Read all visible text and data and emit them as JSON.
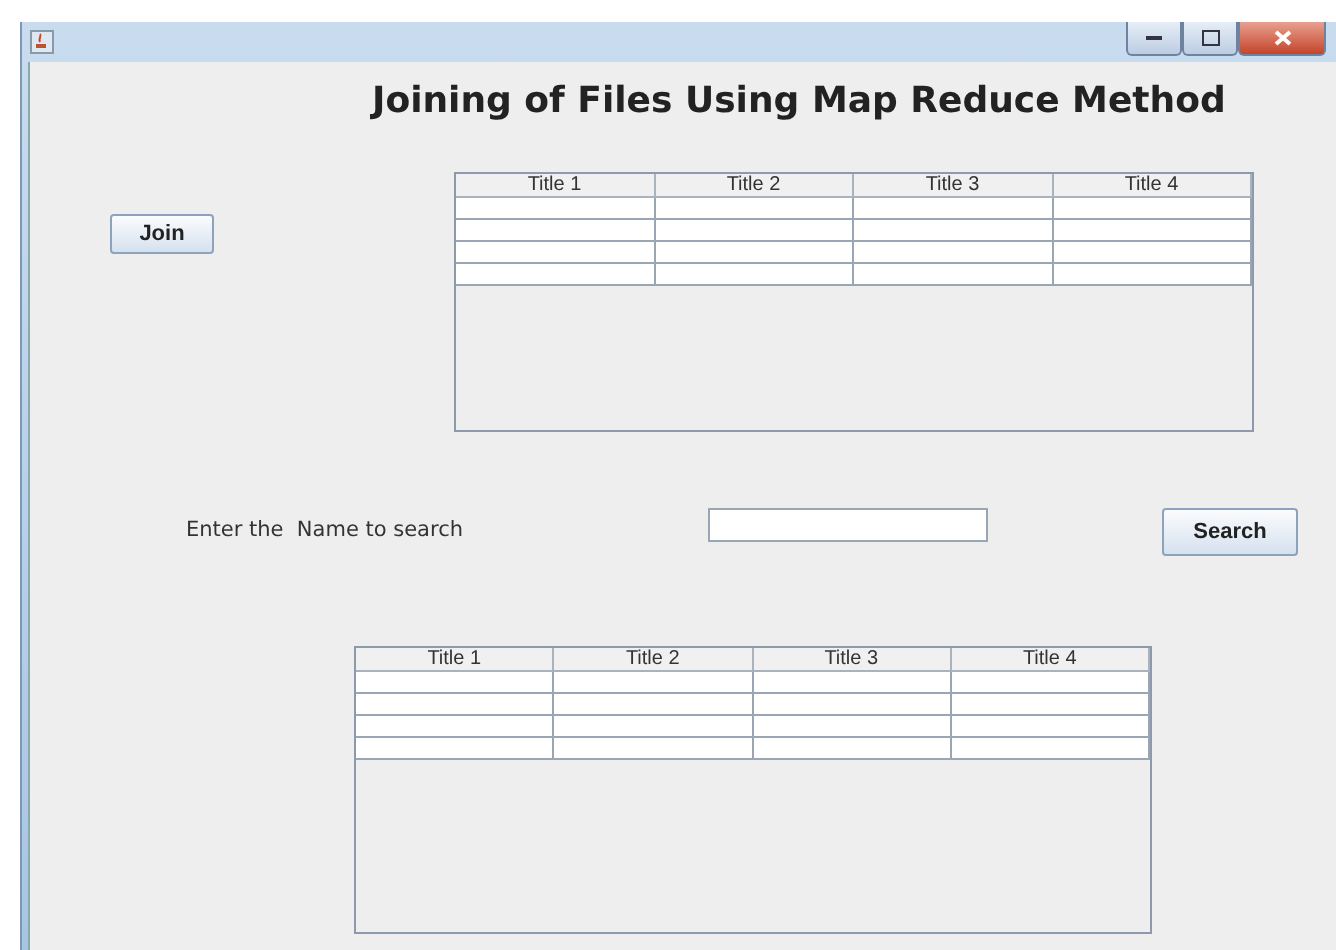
{
  "heading": "Joining of Files Using Map Reduce Method",
  "join_button": "Join",
  "tables": [
    {
      "columns": [
        "Title 1",
        "Title 2",
        "Title 3",
        "Title 4"
      ]
    },
    {
      "columns": [
        "Title 1",
        "Title 2",
        "Title 3",
        "Title 4"
      ]
    }
  ],
  "search": {
    "label": "Enter the  Name to search",
    "button": "Search"
  }
}
